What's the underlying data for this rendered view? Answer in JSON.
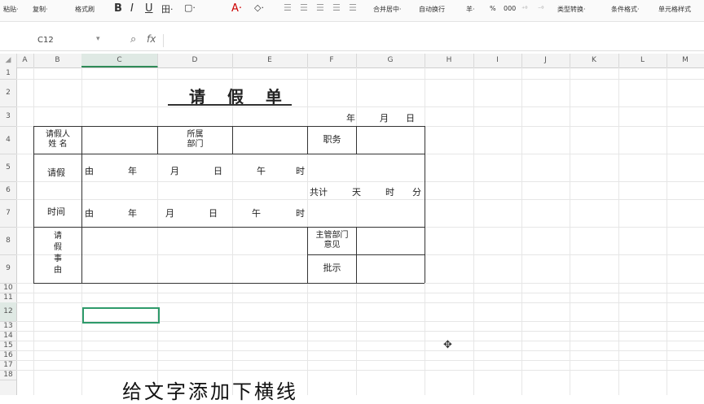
{
  "toolbar": {
    "paste": "粘贴·",
    "copy": "复制·",
    "format_painter": "格式刷",
    "bold": "B",
    "italic": "I",
    "underline": "U",
    "borders": "田·",
    "fill": "▢·",
    "font_color": "A·",
    "clear": "◇·",
    "merge_center": "合并居中·",
    "wrap_text": "自动换行",
    "currency": "羊·",
    "percent": "%",
    "thousands": "000",
    "type_convert": "类型转换·",
    "conditional_format": "条件格式·",
    "cell_style": "单元格样式"
  },
  "formula_bar": {
    "cell_ref": "C12",
    "fx": "fx",
    "formula": ""
  },
  "columns": [
    "A",
    "B",
    "C",
    "D",
    "E",
    "F",
    "G",
    "H",
    "I",
    "J",
    "K",
    "L",
    "M"
  ],
  "rows": [
    "1",
    "2",
    "3",
    "4",
    "5",
    "6",
    "7",
    "8",
    "9",
    "10",
    "11",
    "12",
    "13",
    "14",
    "15",
    "16",
    "17",
    "18"
  ],
  "selected": {
    "column": "C",
    "row": "12"
  },
  "form": {
    "title": "请 假 单",
    "date_line": [
      "年",
      "月",
      "日"
    ],
    "applicant_label": [
      "请假人",
      "姓 名"
    ],
    "dept_label": [
      "所属",
      "部门"
    ],
    "position_label": "职务",
    "leave_label": "请假",
    "time_label": "时间",
    "from_row": [
      "由",
      "年",
      "月",
      "日",
      "午",
      "时"
    ],
    "to_row": [
      "由",
      "年",
      "月",
      "日",
      "午",
      "时"
    ],
    "total_row": [
      "共计",
      "天",
      "时",
      "分"
    ],
    "reason_label": [
      "请",
      "假",
      "事",
      "由"
    ],
    "supervisor_label": [
      "主管部门",
      "意见"
    ],
    "approval_label": "批示"
  },
  "subtitle": "给文字添加下横线"
}
